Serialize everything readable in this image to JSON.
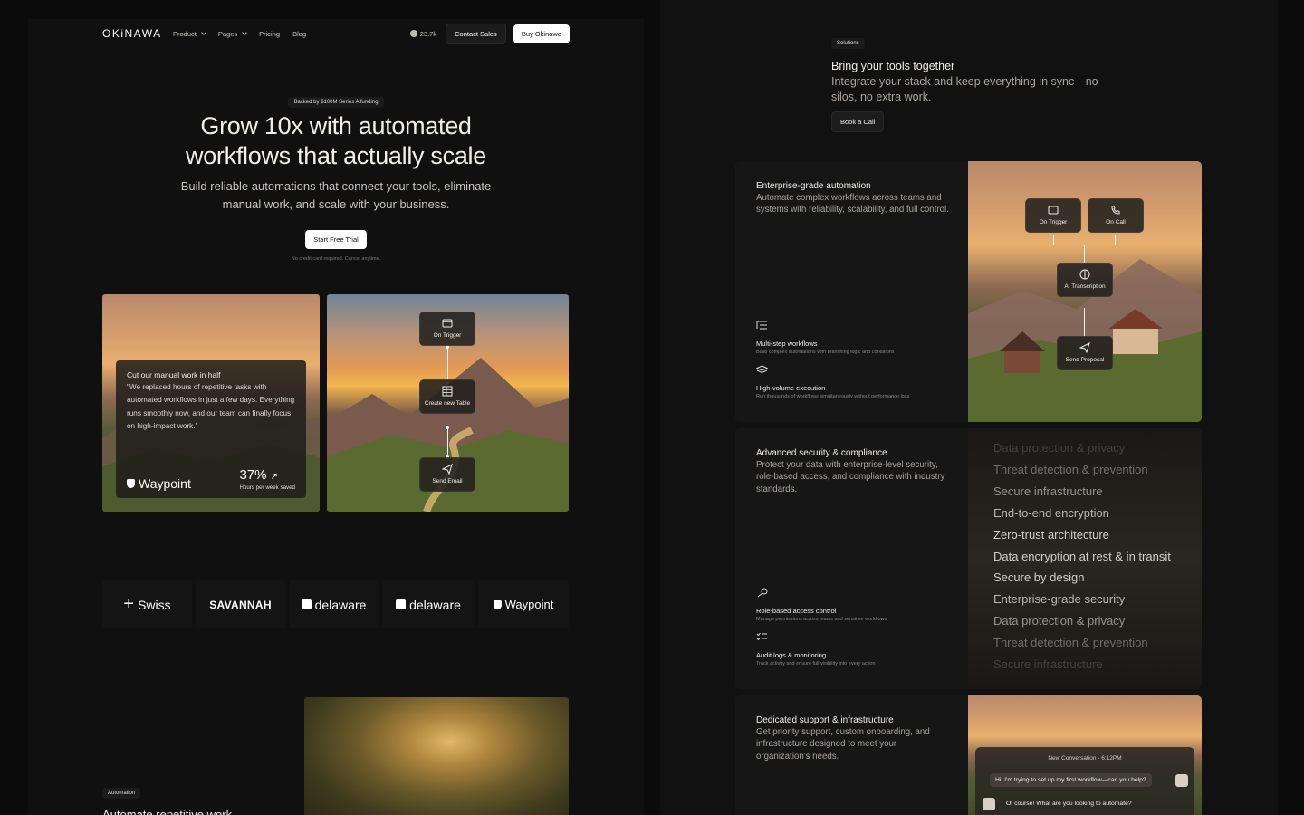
{
  "nav": {
    "logo": "OKiNAWA",
    "items": [
      {
        "label": "Product",
        "dropdown": true
      },
      {
        "label": "Pages",
        "dropdown": true
      },
      {
        "label": "Pricing",
        "dropdown": false
      },
      {
        "label": "Blog",
        "dropdown": false
      }
    ],
    "github_stars": "23.7k",
    "contact_label": "Contact Sales",
    "buy_label": "Buy Okinawa"
  },
  "hero": {
    "badge": "Backed by $100M Series A funding",
    "title_line1": "Grow 10x with automated",
    "title_line2": "workflows that actually scale",
    "subtitle": "Build reliable automations that connect your tools, eliminate manual work, and scale with your business.",
    "cta": "Start Free Trial",
    "note": "No credit card required. Cancel anytime."
  },
  "testimonial": {
    "heading": "Cut our manual work in half",
    "quote": "\"We replaced hours of repetitive tasks with automated workflows in just a few days. Everything runs smoothly now, and our team can finally focus on high-impact work.\"",
    "brand": "Waypoint",
    "stat": "37%",
    "stat_label": "Hours per week saved"
  },
  "flow_left": [
    "On Trigger",
    "Create new Table",
    "Send Email"
  ],
  "logos": [
    "Swiss",
    "SAVANNAH",
    "delaware",
    "delaware",
    "Waypoint"
  ],
  "automation": {
    "chip": "Automation",
    "title": "Automate repetitive work"
  },
  "solutions": {
    "chip": "Solutions",
    "title": "Bring your tools together",
    "subtitle": "Integrate your stack and keep everything in sync—no silos, no extra work.",
    "book": "Book a Call"
  },
  "feature1": {
    "title": "Enterprise-grade automation",
    "desc": "Automate complex workflows across teams and systems with reliability, scalability, and full control.",
    "subs": [
      {
        "title": "Multi-step workflows",
        "desc": "Build complex automations with branching logic and conditions"
      },
      {
        "title": "High-volume execution",
        "desc": "Run thousands of workflows simultaneously without performance loss"
      }
    ],
    "nodes": [
      "On Trigger",
      "On Call",
      "AI Transcription",
      "Send Proposal"
    ]
  },
  "feature2": {
    "title": "Advanced security & compliance",
    "desc": "Protect your data with enterprise-level security, role-based access, and compliance with industry standards.",
    "subs": [
      {
        "title": "Role-based access control",
        "desc": "Manage permissions across teams and sensitive workflows"
      },
      {
        "title": "Audit logs & monitoring",
        "desc": "Track activity and ensure full visibility into every action"
      }
    ],
    "list": [
      "Data protection & privacy",
      "Threat detection & prevention",
      "Secure infrastructure",
      "End-to-end encryption",
      "Zero-trust architecture",
      "Data encryption at rest & in transit",
      "Secure by design",
      "Enterprise-grade security",
      "Data protection & privacy",
      "Threat detection & prevention",
      "Secure infrastructure"
    ]
  },
  "feature3": {
    "title": "Dedicated support & infrastructure",
    "desc": "Get priority support, custom onboarding, and infrastructure designed to meet your organization's needs.",
    "chat_head": "New Conversation - 6:12PM",
    "msg_user": "Hi, I'm trying to set up my first workflow—can you help?",
    "msg_agent": "Of course! What are you looking to automate?"
  }
}
